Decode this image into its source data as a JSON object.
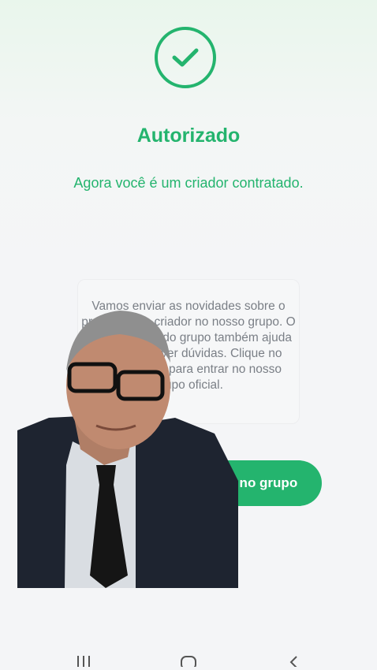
{
  "status": {
    "title": "Autorizado",
    "subtitle": "Agora você é um criador contratado."
  },
  "info": {
    "text": "Vamos enviar as novidades sobre o programa de criador no nosso grupo. O administrador do grupo também ajuda você a resolver dúvidas. Clique no botão abaixo para entrar no nosso grupo oficial."
  },
  "cta": {
    "label": "Entrar no grupo"
  },
  "colors": {
    "accent": "#24b46e",
    "background": "#f4f5f7"
  },
  "icons": {
    "status": "check-circle-icon",
    "nav": [
      "recent-apps-icon",
      "home-icon",
      "back-icon"
    ]
  }
}
